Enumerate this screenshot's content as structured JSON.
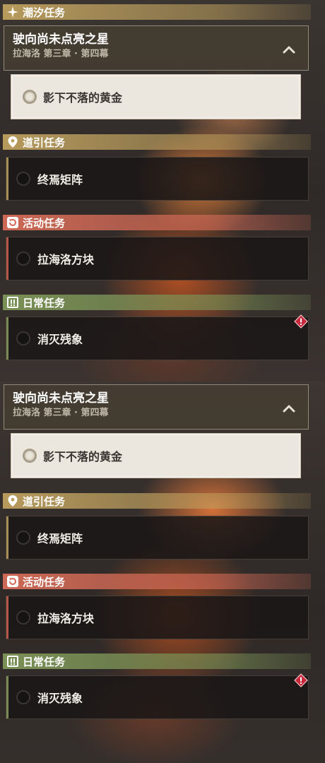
{
  "panels": [
    {
      "header": {
        "icon": "sparkle-icon",
        "label": "潮汐任务"
      },
      "main_task": {
        "title": "驶向尚未点亮之星",
        "subtitle": "拉海洛 第三章 · 第四幕",
        "expand_icon": "chevron-up-icon"
      },
      "sub_task": {
        "label": "影下不落的黄金"
      },
      "categories": [
        {
          "icon": "location-pin-icon",
          "label": "道引任务",
          "task": "终焉矩阵"
        },
        {
          "icon": "refresh-icon",
          "label": "活动任务",
          "task": "拉海洛方块"
        },
        {
          "icon": "exclamation-box-icon",
          "label": "日常任务",
          "task": "消灭残象",
          "alert_icon": "diamond-alert-icon"
        }
      ]
    },
    {
      "main_task": {
        "title": "驶向尚未点亮之星",
        "subtitle": "拉海洛 第三章 · 第四幕",
        "expand_icon": "chevron-up-icon"
      },
      "sub_task": {
        "label": "影下不落的黄金"
      },
      "categories": [
        {
          "icon": "location-pin-icon",
          "label": "道引任务",
          "task": "终焉矩阵"
        },
        {
          "icon": "refresh-icon",
          "label": "活动任务",
          "task": "拉海洛方块"
        },
        {
          "icon": "exclamation-box-icon",
          "label": "日常任务",
          "task": "消灭残象",
          "alert_icon": "diamond-alert-icon"
        }
      ]
    }
  ],
  "colors": {
    "tidal_header": "#bea05f",
    "guide_header": "#bea05f",
    "event_header": "#d66c58",
    "daily_header": "#7e9658",
    "alert": "#c8283c"
  }
}
